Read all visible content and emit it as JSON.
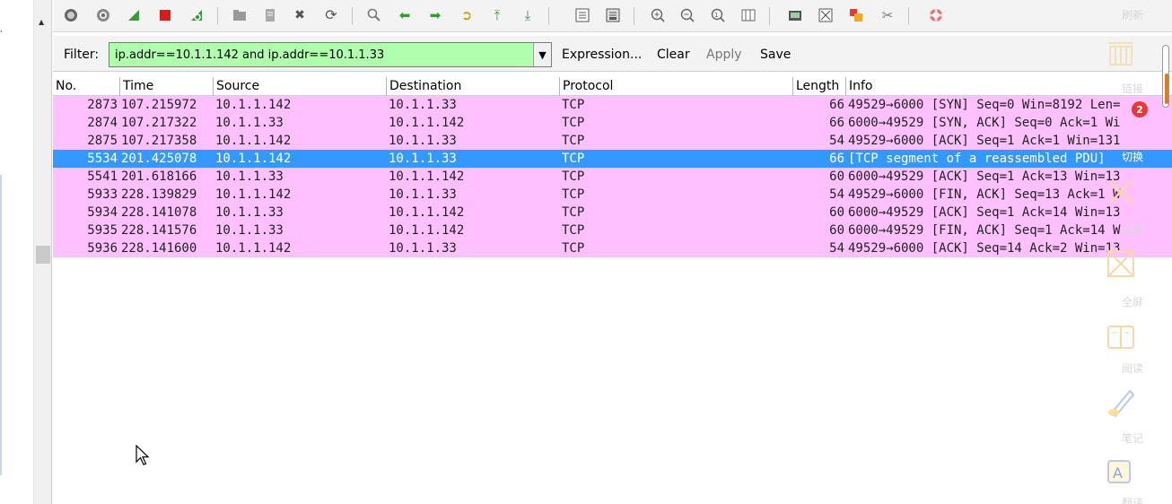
{
  "filter": {
    "label": "Filter:",
    "value": "ip.addr==10.1.1.142 and ip.addr==10.1.1.33",
    "expression_label": "Expression...",
    "clear_label": "Clear",
    "apply_label": "Apply",
    "save_label": "Save",
    "input_bg": "#afffaf"
  },
  "columns": [
    "No.",
    "Time",
    "Source",
    "Destination",
    "Protocol",
    "Length",
    "Info"
  ],
  "packets": [
    {
      "no": "2873",
      "time": "107.215972",
      "source": "10.1.1.142",
      "destination": "10.1.1.33",
      "protocol": "TCP",
      "length": "66",
      "info": "49529→6000 [SYN] Seq=0 Win=8192 Len=",
      "selected": false
    },
    {
      "no": "2874",
      "time": "107.217322",
      "source": "10.1.1.33",
      "destination": "10.1.1.142",
      "protocol": "TCP",
      "length": "66",
      "info": "6000→49529 [SYN, ACK] Seq=0 Ack=1 Wi",
      "selected": false
    },
    {
      "no": "2875",
      "time": "107.217358",
      "source": "10.1.1.142",
      "destination": "10.1.1.33",
      "protocol": "TCP",
      "length": "54",
      "info": "49529→6000 [ACK] Seq=1 Ack=1 Win=131",
      "selected": false
    },
    {
      "no": "5534",
      "time": "201.425078",
      "source": "10.1.1.142",
      "destination": "10.1.1.33",
      "protocol": "TCP",
      "length": "66",
      "info": "[TCP segment of a reassembled PDU]",
      "selected": true
    },
    {
      "no": "5541",
      "time": "201.618166",
      "source": "10.1.1.33",
      "destination": "10.1.1.142",
      "protocol": "TCP",
      "length": "60",
      "info": "6000→49529 [ACK] Seq=1 Ack=13 Win=13",
      "selected": false
    },
    {
      "no": "5933",
      "time": "228.139829",
      "source": "10.1.1.142",
      "destination": "10.1.1.33",
      "protocol": "TCP",
      "length": "54",
      "info": "49529→6000 [FIN, ACK] Seq=13 Ack=1 W",
      "selected": false
    },
    {
      "no": "5934",
      "time": "228.141078",
      "source": "10.1.1.33",
      "destination": "10.1.1.142",
      "protocol": "TCP",
      "length": "60",
      "info": "6000→49529 [ACK] Seq=1 Ack=14 Win=13",
      "selected": false
    },
    {
      "no": "5935",
      "time": "228.141576",
      "source": "10.1.1.33",
      "destination": "10.1.1.142",
      "protocol": "TCP",
      "length": "60",
      "info": "6000→49529 [FIN, ACK] Seq=1 Ack=14 W",
      "selected": false
    },
    {
      "no": "5936",
      "time": "228.141600",
      "source": "10.1.1.142",
      "destination": "10.1.1.33",
      "protocol": "TCP",
      "length": "54",
      "info": "49529→6000 [ACK] Seq=14 Ack=2 Win=13",
      "selected": false
    }
  ],
  "colors": {
    "row_bg": "#ffc0ff",
    "selected_bg": "#3399ff",
    "filter_ok": "#afffaf"
  },
  "toolbar_icons": [
    "interface-list-icon",
    "capture-options-icon",
    "start-capture-icon",
    "stop-capture-icon",
    "restart-capture-icon",
    "open-file-icon",
    "save-file-icon",
    "close-file-icon",
    "reload-icon",
    "find-packet-icon",
    "go-back-icon",
    "go-forward-icon",
    "go-to-packet-icon",
    "go-first-icon",
    "go-last-icon",
    "colorize-icon",
    "auto-scroll-icon",
    "zoom-in-icon",
    "zoom-out-icon",
    "zoom-normal-icon",
    "resize-columns-icon",
    "capture-filters-icon",
    "display-filters-icon",
    "coloring-rules-icon",
    "preferences-icon",
    "help-icon"
  ],
  "side_panel": {
    "badge_count": "2",
    "items": [
      "刷新",
      "链接",
      "切换",
      "还原",
      "全屏",
      "阅读",
      "笔记",
      "翻译"
    ]
  }
}
